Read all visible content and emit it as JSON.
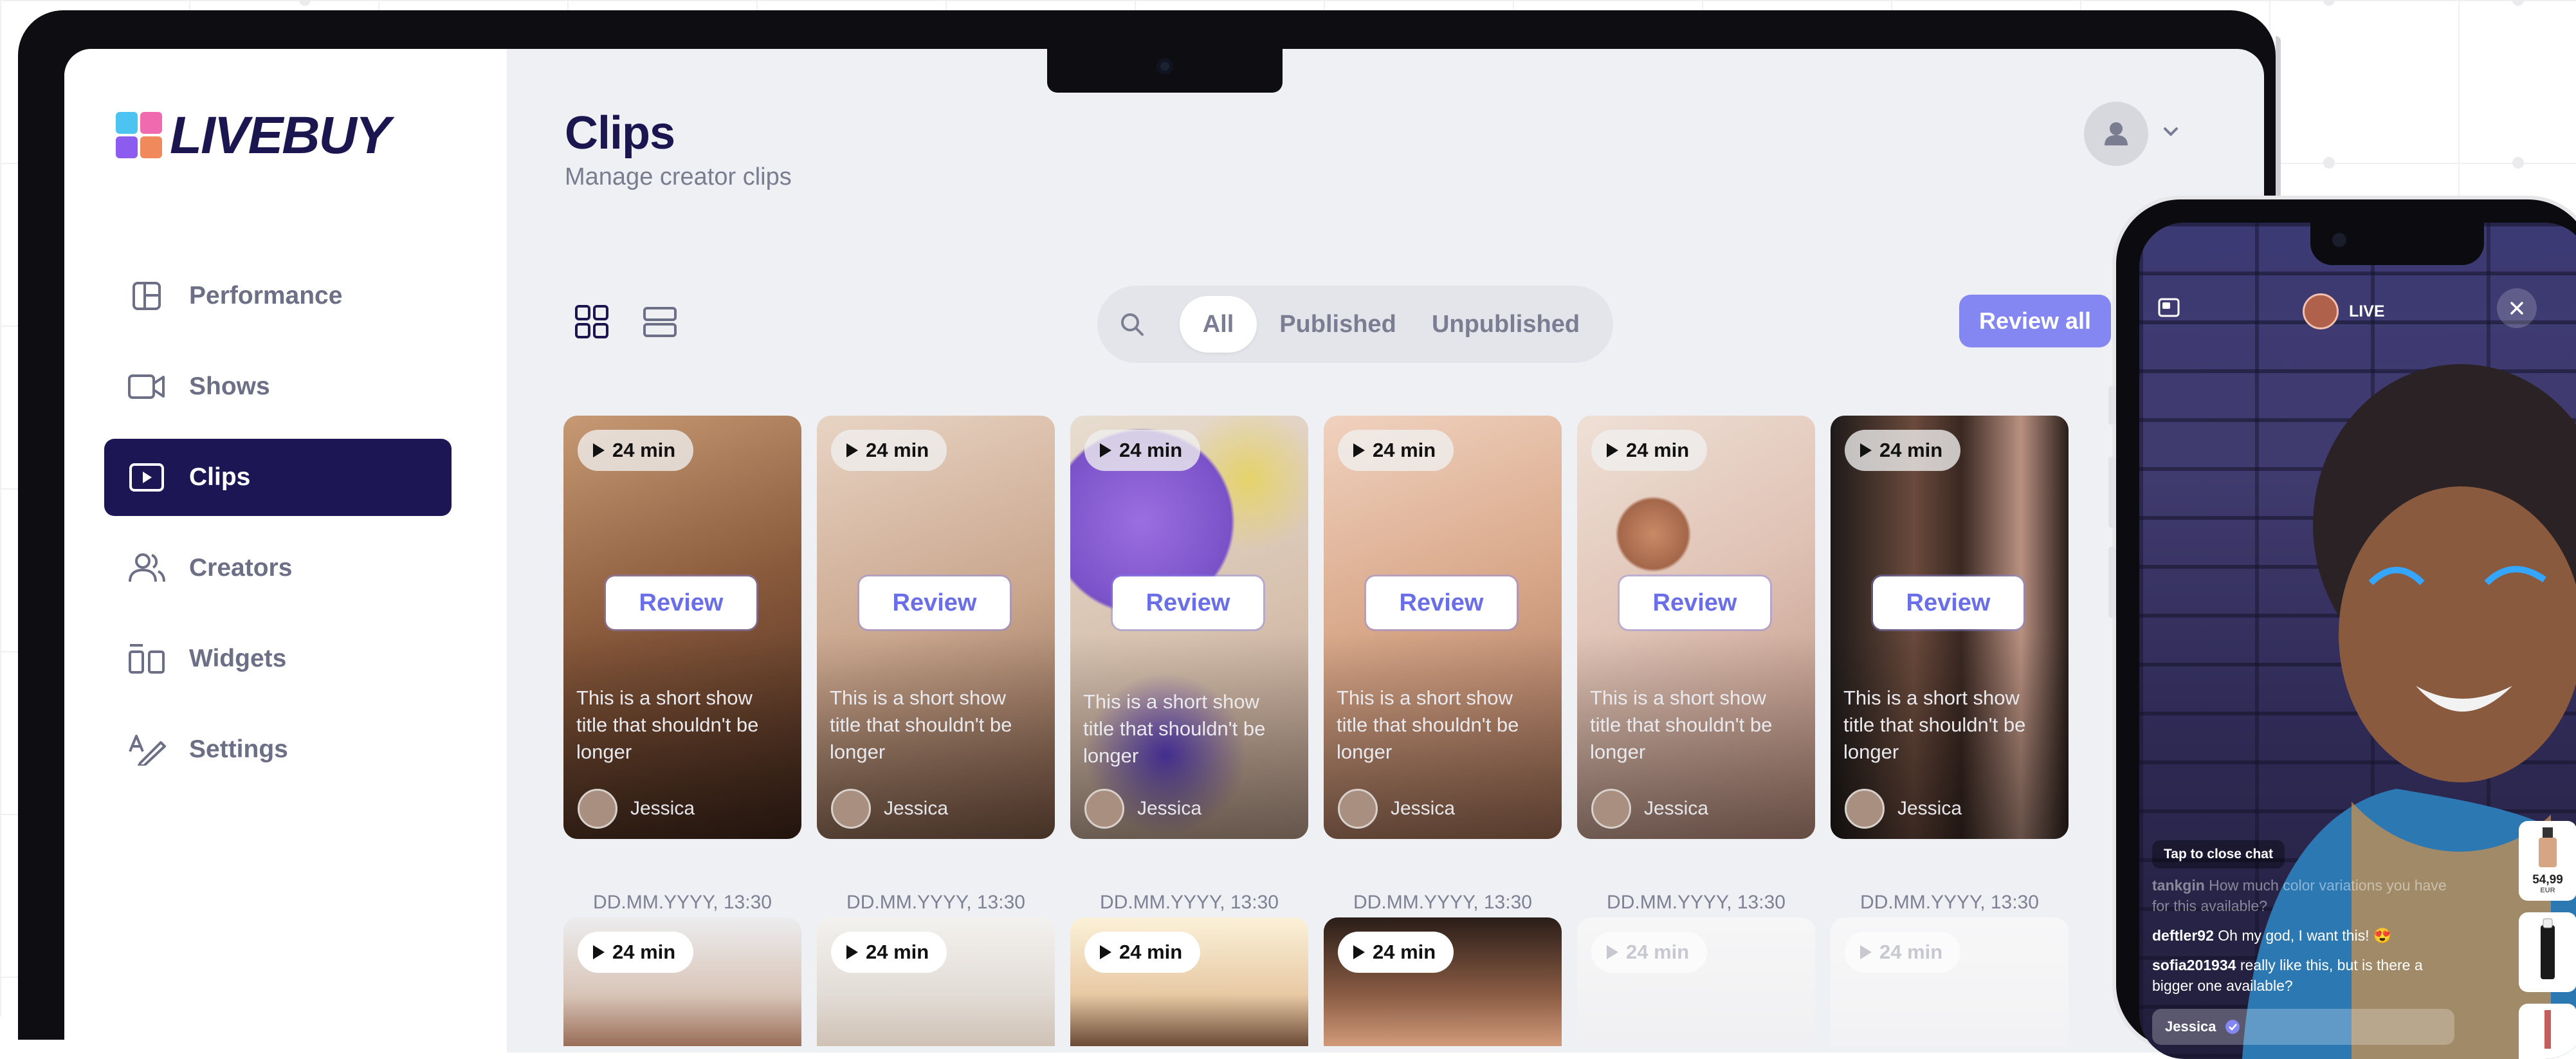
{
  "app": {
    "brand": "LIVEBUY",
    "brand_colors": {
      "primary": "#1c1655",
      "accent": "#8487f2",
      "logo": [
        "#4cc3f0",
        "#f06ab0",
        "#8c5cf0",
        "#f08a5c"
      ]
    }
  },
  "sidebar": {
    "items": [
      {
        "label": "Performance",
        "icon": "layout-icon",
        "active": false
      },
      {
        "label": "Shows",
        "icon": "video-camera-icon",
        "active": false
      },
      {
        "label": "Clips",
        "icon": "play-square-icon",
        "active": true
      },
      {
        "label": "Creators",
        "icon": "users-icon",
        "active": false
      },
      {
        "label": "Widgets",
        "icon": "widgets-icon",
        "active": false
      },
      {
        "label": "Settings",
        "icon": "settings-pen-icon",
        "active": false
      }
    ]
  },
  "header": {
    "title": "Clips",
    "subtitle": "Manage creator clips"
  },
  "toolbar": {
    "filters": [
      "All",
      "Published",
      "Unpublished"
    ],
    "active_filter": "All",
    "review_all_label": "Review all"
  },
  "clips": [
    {
      "duration": "24 min",
      "review_label": "Review",
      "title": "This is a short show title that shouldn't be longer",
      "author": "Jessica",
      "date": "DD.MM.YYYY, 13:30"
    },
    {
      "duration": "24 min",
      "review_label": "Review",
      "title": "This is a short show title that shouldn't be longer",
      "author": "Jessica",
      "date": "DD.MM.YYYY, 13:30"
    },
    {
      "duration": "24 min",
      "review_label": "Review",
      "title": "This is a short show title that shouldn't be longer",
      "author": "Jessica",
      "date": "DD.MM.YYYY, 13:30"
    },
    {
      "duration": "24 min",
      "review_label": "Review",
      "title": "This is a short show title that shouldn't be longer",
      "author": "Jessica",
      "date": "DD.MM.YYYY, 13:30"
    },
    {
      "duration": "24 min",
      "review_label": "Review",
      "title": "This is a short show title that shouldn't be longer",
      "author": "Jessica",
      "date": "DD.MM.YYYY, 13:30"
    },
    {
      "duration": "24 min",
      "review_label": "Review",
      "title": "This is a short show title that shouldn't be longer",
      "author": "Jessica",
      "date": "DD.MM.YYYY, 13:30"
    }
  ],
  "clips_row2": [
    {
      "duration": "24 min"
    },
    {
      "duration": "24 min"
    },
    {
      "duration": "24 min"
    },
    {
      "duration": "24 min"
    },
    {
      "duration": "24 min"
    },
    {
      "duration": "24 min"
    }
  ],
  "phone": {
    "live_label": "LIVE",
    "tap_to_close": "Tap to close chat",
    "chat": [
      {
        "user": "tankgin",
        "text": "How much color variations you have for this available?"
      },
      {
        "user": "deftler92",
        "text": "Oh my god, I want this! 😍"
      },
      {
        "user": "sofia201934",
        "text": "really like this, but is there a bigger one available?"
      }
    ],
    "host_name": "Jessica",
    "product_price": "54,99",
    "product_currency": "EUR"
  }
}
